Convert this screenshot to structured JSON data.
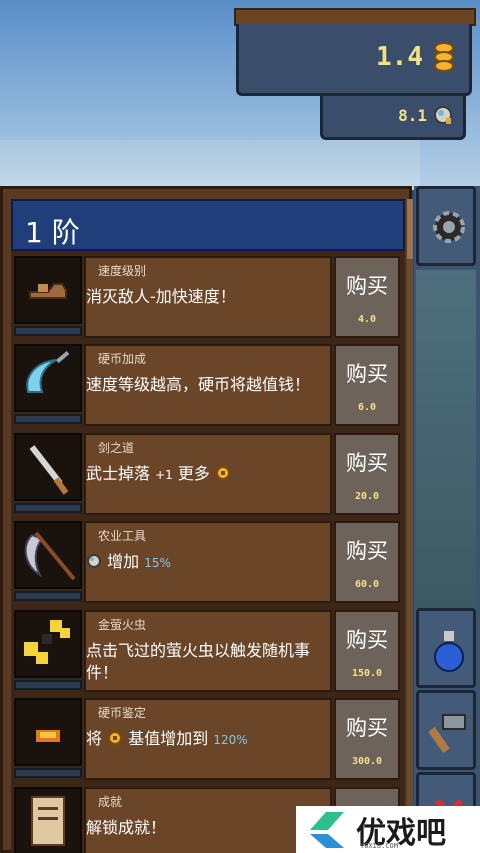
{
  "currency": {
    "coins": "1.4",
    "gems": "8.1"
  },
  "tier_label": "1 阶",
  "items": [
    {
      "title": "速度级别",
      "desc": "消灭敌人-加快速度！",
      "buy_label": "购买",
      "price": "4.0",
      "icon": "boots-icon"
    },
    {
      "title": "硬币加成",
      "desc": "速度等级越高，硬币将越值钱！",
      "buy_label": "购买",
      "price": "6.0",
      "icon": "blade-swoosh-icon"
    },
    {
      "title": "剑之道",
      "desc_prefix": "武士掉落",
      "desc_highlight": "+1",
      "desc_suffix": "更多",
      "buy_label": "购买",
      "price": "20.0",
      "icon": "sword-icon"
    },
    {
      "title": "农业工具",
      "desc_prefix": "增加",
      "desc_highlight": "15%",
      "buy_label": "购买",
      "price": "60.0",
      "icon": "scythe-icon"
    },
    {
      "title": "金萤火虫",
      "desc": "点击飞过的萤火虫以触发随机事件！",
      "buy_label": "购买",
      "price": "150.0",
      "icon": "firefly-icon"
    },
    {
      "title": "硬币鉴定",
      "desc_prefix": "将",
      "desc_mid": "基值增加到",
      "desc_highlight": "120%",
      "buy_label": "购买",
      "price": "300.0",
      "icon": "gem-icon"
    },
    {
      "title": "成就",
      "desc": "解锁成就！",
      "buy_label": "购买",
      "icon": "scroll-icon"
    }
  ],
  "watermark": {
    "text": "优戏吧",
    "sub": "YOXI8.COM"
  },
  "colors": {
    "panel_brown": "#6b4528",
    "tier_blue": "#1f3e7a",
    "gold_text": "#f5e08a",
    "highlight_blue": "#7ec8f0"
  }
}
